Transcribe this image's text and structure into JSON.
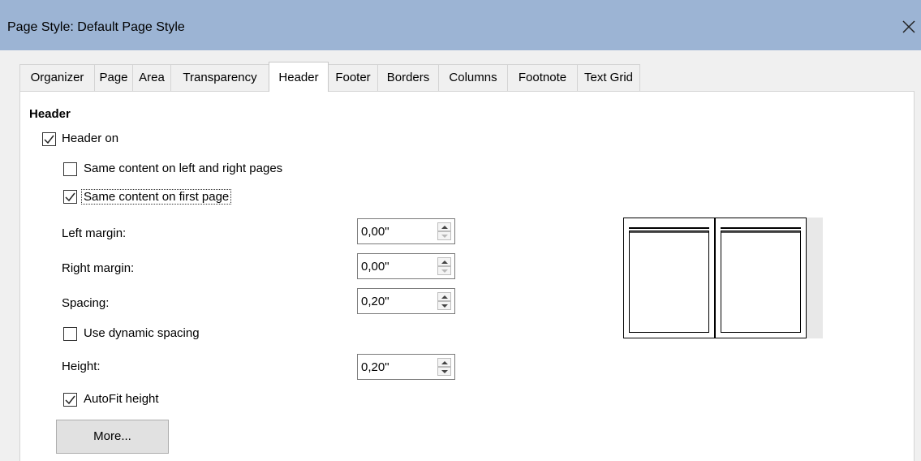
{
  "window": {
    "title": "Page Style: Default Page Style"
  },
  "tabs": [
    {
      "label": "Organizer"
    },
    {
      "label": "Page"
    },
    {
      "label": "Area"
    },
    {
      "label": "Transparency"
    },
    {
      "label": "Header"
    },
    {
      "label": "Footer"
    },
    {
      "label": "Borders"
    },
    {
      "label": "Columns"
    },
    {
      "label": "Footnote"
    },
    {
      "label": "Text Grid"
    }
  ],
  "active_tab": "Header",
  "section": {
    "title": "Header"
  },
  "checkboxes": {
    "header_on": {
      "label": "Header on",
      "checked": true
    },
    "same_left_right": {
      "label": "Same content on left and right pages",
      "checked": false
    },
    "same_first_page": {
      "label": "Same content on first page",
      "checked": true
    },
    "dynamic_spacing": {
      "label": "Use dynamic spacing",
      "checked": false
    },
    "autofit_height": {
      "label": "AutoFit height",
      "checked": true
    }
  },
  "fields": {
    "left_margin": {
      "label": "Left margin:",
      "value": "0,00\""
    },
    "right_margin": {
      "label": "Right margin:",
      "value": "0,00\""
    },
    "spacing": {
      "label": "Spacing:",
      "value": "0,20\""
    },
    "height": {
      "label": "Height:",
      "value": "0,20\""
    }
  },
  "buttons": {
    "more": "More..."
  },
  "icons": {
    "close": "close-icon",
    "check": "check-icon"
  },
  "colors": {
    "titlebar": "#9cb4d4",
    "panel": "#ffffff",
    "dialog": "#f0f0f0"
  }
}
